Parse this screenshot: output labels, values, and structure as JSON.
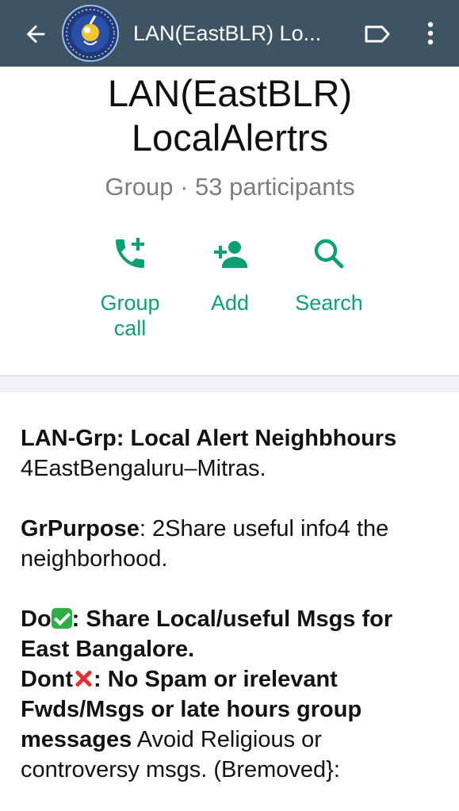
{
  "header": {
    "title": "LAN(EastBLR) Lo...",
    "avatar_text": "INTERNATIONAL MEN'S DAY",
    "avatar_subtext": "19 November"
  },
  "group": {
    "name_line1": "LAN(EastBLR)",
    "name_line2": "LocalAlertrs",
    "subtitle": "Group · 53 participants"
  },
  "actions": {
    "call_line1": "Group",
    "call_line2": "call",
    "add": "Add",
    "search": "Search"
  },
  "description": {
    "l1": "LAN-Grp: Local Alert Neighbhours",
    "l2": "4EastBengaluru–Mitras.",
    "purpose_label": "GrPurpose",
    "purpose_text": ": 2Share useful info4 the",
    "purpose_text2": "neighborhood.",
    "do_label": "Do",
    "do_text": ": Share Local/useful Msgs for",
    "do_text2": "East Bangalore.",
    "dont_label": "Dont",
    "dont_text": ": No Spam or irelevant",
    "dont_text2": "Fwds/Msgs or late hours group",
    "dont_text3_bold": "messages",
    "dont_text3": " Avoid Religious or",
    "dont_text4": "controversy msgs. (Bremoved}:"
  },
  "colors": {
    "header_bg": "#3e5463",
    "accent": "#0f9d74",
    "subtitle": "#7b7f83"
  },
  "icons": [
    "back-arrow-icon",
    "label-icon",
    "more-vert-icon",
    "add-call-icon",
    "add-person-icon",
    "search-icon",
    "check-emoji-icon",
    "cross-emoji-icon"
  ]
}
